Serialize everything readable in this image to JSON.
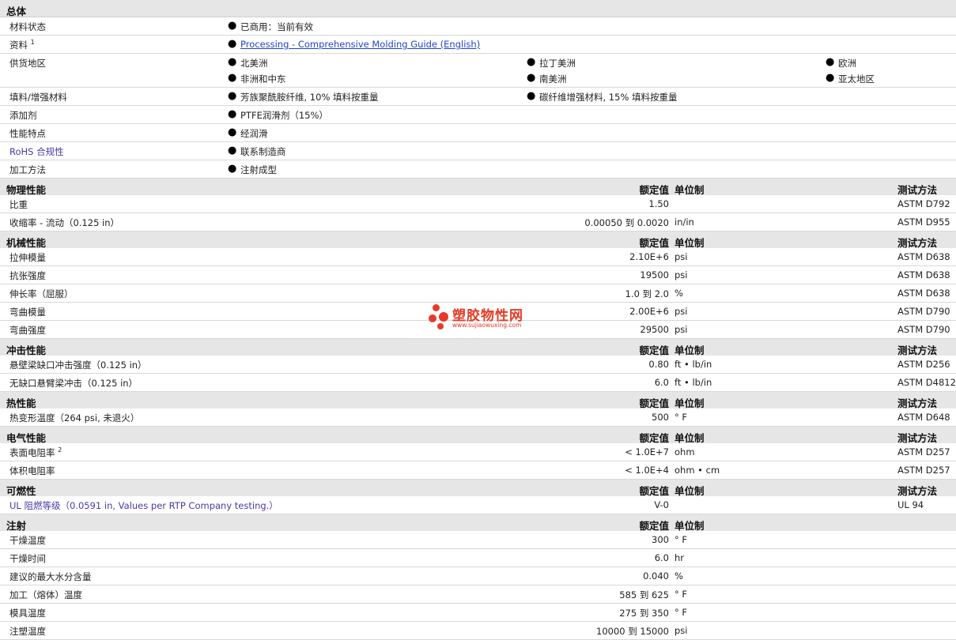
{
  "general": {
    "header": "总体",
    "rows": {
      "status": {
        "label": "材料状态",
        "value": "已商用：当前有效"
      },
      "docs": {
        "label": "资料",
        "sup": "1",
        "link": "Processing - Comprehensive Molding Guide (English)"
      },
      "regions": {
        "label": "供货地区",
        "items": [
          "北美洲",
          "拉丁美洲",
          "欧洲",
          "非洲和中东",
          "南美洲",
          "亚太地区"
        ]
      },
      "filler": {
        "label": "填料/增强材料",
        "items": [
          "芳族聚酰胺纤维, 10% 填料按重量",
          "碳纤维增强材料, 15% 填料按重量"
        ]
      },
      "additive": {
        "label": "添加剂",
        "value": "PTFE润滑剂（15%）"
      },
      "features": {
        "label": "性能特点",
        "value": "经润滑"
      },
      "rohs": {
        "label": "RoHS 合规性",
        "value": "联系制造商"
      },
      "processing": {
        "label": "加工方法",
        "value": "注射成型"
      }
    }
  },
  "columns": {
    "value": "额定值",
    "unit": "单位制",
    "method": "测试方法"
  },
  "bullet": "●",
  "sections": [
    {
      "title": "物理性能",
      "rows": [
        {
          "label": "比重",
          "value": "1.50",
          "unit": "",
          "method": "ASTM D792"
        },
        {
          "label": "收缩率  - 流动（0.125 in）",
          "value": "0.00050 到  0.0020",
          "unit": "in/in",
          "method": "ASTM D955"
        }
      ]
    },
    {
      "title": "机械性能",
      "rows": [
        {
          "label": "拉伸模量",
          "value": "2.10E+6",
          "unit": "psi",
          "method": "ASTM D638"
        },
        {
          "label": "抗张强度",
          "value": "19500",
          "unit": "psi",
          "method": "ASTM D638"
        },
        {
          "label": "伸长率（屈服）",
          "value": "1.0 到  2.0",
          "unit": "%",
          "method": "ASTM D638"
        },
        {
          "label": "弯曲模量",
          "value": "2.00E+6",
          "unit": "psi",
          "method": "ASTM D790"
        },
        {
          "label": "弯曲强度",
          "value": "29500",
          "unit": "psi",
          "method": "ASTM D790"
        }
      ]
    },
    {
      "title": "冲击性能",
      "rows": [
        {
          "label": "悬壁梁缺口冲击强度（0.125 in）",
          "value": "0.80",
          "unit": "ft • lb/in",
          "method": "ASTM D256"
        },
        {
          "label": "无缺口悬臂梁冲击（0.125 in）",
          "value": "6.0",
          "unit": "ft • lb/in",
          "method": "ASTM D4812"
        }
      ]
    },
    {
      "title": "热性能",
      "rows": [
        {
          "label": "热变形温度（264 psi, 未退火）",
          "value": "500",
          "unit": "° F",
          "method": "ASTM D648"
        }
      ]
    },
    {
      "title": "电气性能",
      "rows": [
        {
          "label": "表面电阻率",
          "sup": "2",
          "value": "< 1.0E+7",
          "unit": "ohm",
          "method": "ASTM D257"
        },
        {
          "label": "体积电阻率",
          "value": "< 1.0E+4",
          "unit": "ohm • cm",
          "method": "ASTM D257"
        }
      ]
    },
    {
      "title": "可燃性",
      "rows": [
        {
          "label": "UL 阻燃等级（0.0591 in, Values per RTP Company testing.）",
          "value": "V-0",
          "unit": "",
          "method": "UL 94"
        }
      ]
    },
    {
      "title": "注射",
      "nomethod": true,
      "rows": [
        {
          "label": "干燥温度",
          "value": "300",
          "unit": "° F",
          "method": ""
        },
        {
          "label": "干燥时间",
          "value": "6.0",
          "unit": "hr",
          "method": ""
        },
        {
          "label": "建议的最大水分含量",
          "value": "0.040",
          "unit": "%",
          "method": ""
        },
        {
          "label": "加工（熔体）温度",
          "value": "585 到  625",
          "unit": "° F",
          "method": ""
        },
        {
          "label": "模具温度",
          "value": "275 到  350",
          "unit": "° F",
          "method": ""
        },
        {
          "label": "注塑温度",
          "value": "10000 到  15000",
          "unit": "psi",
          "method": ""
        }
      ]
    }
  ],
  "watermark": {
    "title": "塑胶物性网",
    "url": "www.sujiaowuxing.com",
    "color": "#e23a24"
  }
}
